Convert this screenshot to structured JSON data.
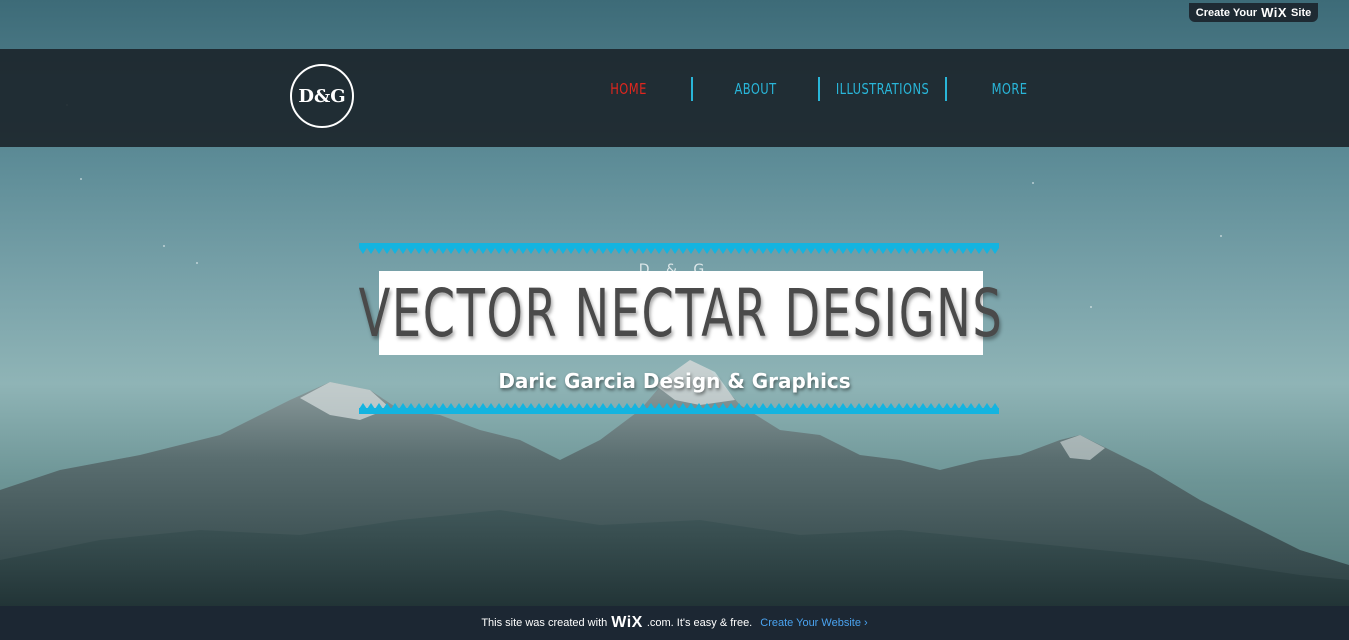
{
  "top_badge": {
    "prefix": "Create Your",
    "brand": "WiX",
    "suffix": "Site"
  },
  "header": {
    "logo_text": "D&G",
    "nav": [
      {
        "label": "HOME",
        "active": true
      },
      {
        "label": "ABOUT",
        "active": false
      },
      {
        "label": "ILLUSTRATIONS",
        "active": false
      },
      {
        "label": "MORE",
        "active": false
      }
    ]
  },
  "hero": {
    "small_text": "D & G",
    "title": "VECTOR NECTAR DESIGNS",
    "subtitle": "Daric Garcia Design & Graphics"
  },
  "footer_bar": {
    "prefix": "This site was created with",
    "brand": "WiX",
    "suffix": ".com. It's easy & free.",
    "cta": "Create Your Website",
    "cta_icon": "chevron-right-icon"
  },
  "colors": {
    "nav_text": "#29b6d9",
    "nav_active": "#e0261e",
    "accent_cyan": "#14b4e0",
    "header_bg": "#1c262c",
    "footer_bg": "#1c2733",
    "cta_link": "#4aa3f0"
  }
}
